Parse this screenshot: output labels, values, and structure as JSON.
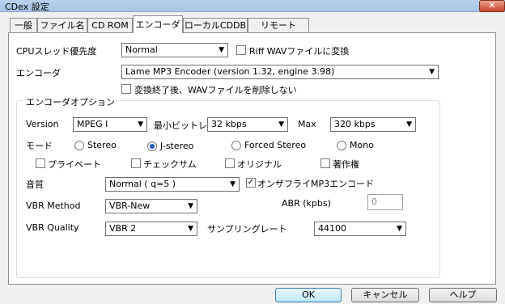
{
  "window": {
    "title": "CDex 設定",
    "close_glyph": "✕"
  },
  "tabs": [
    "一般",
    "ファイル名",
    "CD ROM",
    "エンコーダ",
    "ローカルCDDB",
    "リモートCDDB"
  ],
  "main": {
    "cpu_label": "CPUスレッド優先度",
    "cpu_value": "Normal",
    "riff_label": "Riff WAVファイルに変換",
    "encoder_label": "エンコーダ",
    "encoder_value": "Lame MP3 Encoder (version 1.32, engine 3.98)",
    "keep_wav_label": "変換終了後、WAVファイルを削除しない"
  },
  "options": {
    "group_title": "エンコーダオプション",
    "version_label": "Version",
    "version_value": "MPEG I",
    "min_bitrate_label": "最小ビットレ",
    "min_bitrate_value": "32 kbps",
    "max_label": "Max",
    "max_value": "320 kbps",
    "mode_label": "モード",
    "modes": [
      "Stereo",
      "J-stereo",
      "Forced Stereo",
      "Mono"
    ],
    "mode_selected": "J-stereo",
    "private_label": "プライベート",
    "checksum_label": "チェックサム",
    "original_label": "オリジナル",
    "copyright_label": "著作権",
    "quality_label": "音質",
    "quality_value": "Normal ( q=5 )",
    "onthefly_label": "オンザフライMP3エンコード",
    "onthefly_checked": true,
    "vbr_method_label": "VBR Method",
    "vbr_method_value": "VBR-New",
    "abr_label": "ABR (kpbs)",
    "abr_value": "0",
    "vbr_quality_label": "VBR Quality",
    "vbr_quality_value": "VBR 2",
    "samplerate_label": "サンプリングレート",
    "samplerate_value": "44100"
  },
  "buttons": {
    "ok": "OK",
    "cancel": "キャンセル",
    "help": "ヘルプ"
  },
  "icons": {
    "dropdown": "▼",
    "check": "✓"
  }
}
